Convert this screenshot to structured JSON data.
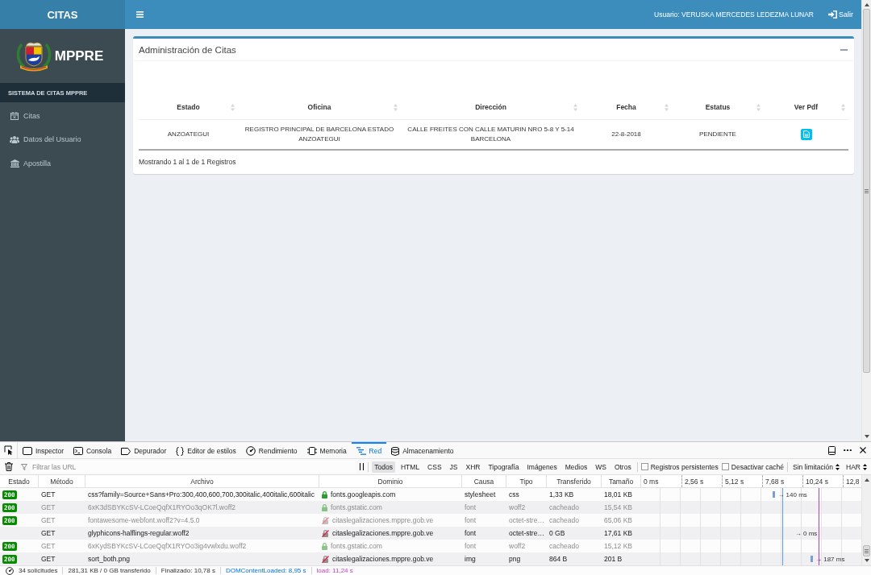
{
  "header": {
    "brand": "CITAS",
    "user": "Usuario: VERUSKA MERCEDES LEDEZMA LUNAR",
    "logout": "Salir"
  },
  "sidebar": {
    "logo_text": "MPPRE",
    "section": "SISTEMA DE CITAS MPPRE",
    "items": [
      {
        "label": "Citas",
        "selected": false
      },
      {
        "label": "Datos del Usuario",
        "selected": false
      },
      {
        "label": "Apostilla",
        "selected": false
      }
    ]
  },
  "panel": {
    "title": "Administración de Citas",
    "table": {
      "columns": [
        "Estado",
        "Oficina",
        "Dirección",
        "Fecha",
        "Estatus",
        "Ver Pdf"
      ],
      "rows": [
        {
          "cells": [
            "ANZOATEGUI",
            "REGISTRO PRINCIPAL DE BARCELONA ESTADO ANZOATEGUI",
            "CALLE FREITES CON CALLE MATURIN NRO 5-8 Y 5-14 BARCELONA",
            "22-8-2018",
            "PENDIENTE"
          ],
          "pdf": true
        }
      ]
    },
    "info": "Mostrando 1 al 1 de 1 Registros"
  },
  "devtools": {
    "tabs": [
      {
        "label": "Inspector",
        "selected": false
      },
      {
        "label": "Consola",
        "selected": false
      },
      {
        "label": "Depurador",
        "selected": false
      },
      {
        "label": "Editor de estilos",
        "selected": false
      },
      {
        "label": "Rendimiento",
        "selected": false
      },
      {
        "label": "Memoria",
        "selected": false
      },
      {
        "label": "Red",
        "selected": true
      },
      {
        "label": "Almacenamiento",
        "selected": false
      }
    ],
    "filter": {
      "placeholder": "Filtrar las URL"
    },
    "type_filters": [
      {
        "label": "Todos",
        "selected": true
      },
      {
        "label": "HTML",
        "selected": false
      },
      {
        "label": "CSS",
        "selected": false
      },
      {
        "label": "JS",
        "selected": false
      },
      {
        "label": "XHR",
        "selected": false
      },
      {
        "label": "Tipografía",
        "selected": false
      },
      {
        "label": "Imágenes",
        "selected": false
      },
      {
        "label": "Medios",
        "selected": false
      },
      {
        "label": "WS",
        "selected": false
      },
      {
        "label": "Otros",
        "selected": false
      }
    ],
    "options": [
      {
        "label": "Registros persistentes",
        "checked": false
      },
      {
        "label": "Desactivar caché",
        "checked": false
      }
    ],
    "throttling": "Sin limitación",
    "export": "HAR",
    "columns": [
      "Estado",
      "Método",
      "Archivo",
      "Dominio",
      "Causa",
      "Tipo",
      "Transferido",
      "Tamaño"
    ],
    "timeline": {
      "ticks": [
        "0 ms",
        "2,56 s",
        "5,12 s",
        "7,68 s",
        "10,24 s",
        "12,8"
      ],
      "markers": [
        {
          "kind": "domcontentloaded",
          "level": 0.642
        },
        {
          "kind": "load",
          "level": 0.806
        }
      ]
    },
    "requests": [
      {
        "status": "200",
        "method": "GET",
        "file": "css?family=Source+Sans+Pro:300,400,600,700,300italic,400italic,600italic",
        "secure": true,
        "domain": "fonts.googleapis.com",
        "cause": "stylesheet",
        "type": "css",
        "transferred": "1,33 KB",
        "size": "18,01 KB",
        "cached": false,
        "timing": {
          "level": 0.6,
          "bar": true,
          "label": "→ 140 ms"
        }
      },
      {
        "status": "200",
        "method": "GET",
        "file": "6xK3dSBYKcSV-LCoeQqfX1RYOo3qOK7l.woff2",
        "secure": true,
        "domain": "fonts.gstatic.com",
        "cause": "font",
        "type": "woff2",
        "transferred": "cacheado",
        "size": "15,54 KB",
        "cached": true
      },
      {
        "status": "200",
        "method": "GET",
        "file": "fontawesome-webfont.woff2?v=4.5.0",
        "secure": false,
        "domain": "citaslegalizaciones.mppre.gob.ve",
        "cause": "font",
        "type": "octet-stre…",
        "transferred": "cacheado",
        "size": "65,06 KB",
        "cached": true
      },
      {
        "method": "GET",
        "file": "glyphicons-halflings-regular.woff2",
        "secure": false,
        "domain": "citaslegalizaciones.mppre.gob.ve",
        "cause": "font",
        "type": "octet-stre…",
        "transferred": "0 GB",
        "size": "17,61 KB",
        "cached": false,
        "timing": {
          "level": 0.7,
          "bar": false,
          "label": "→ 0 ms"
        }
      },
      {
        "status": "200",
        "method": "GET",
        "file": "6xKydSBYKcSV-LCoeQqfX1RYOo3ig4vwlxdu.woff2",
        "secure": true,
        "domain": "fonts.gstatic.com",
        "cause": "font",
        "type": "woff2",
        "transferred": "cacheado",
        "size": "15,12 KB",
        "cached": true
      },
      {
        "status": "200",
        "method": "GET",
        "file": "sort_both.png",
        "secure": false,
        "domain": "citaslegalizaciones.mppre.gob.ve",
        "cause": "img",
        "type": "png",
        "transferred": "864 B",
        "size": "201 B",
        "cached": false,
        "timing": {
          "level": 0.77,
          "bar": true,
          "label": "→ 187 ms"
        }
      }
    ],
    "summary": [
      {
        "kind": "plain",
        "text": "34 solicitudes"
      },
      {
        "kind": "plain",
        "text": "281,31 KB / 0 GB transferido"
      },
      {
        "kind": "plain",
        "text": "Finalizado: 10,78 s"
      },
      {
        "kind": "domcontentloaded",
        "text": "DOMContentLoaded: 8,95 s"
      },
      {
        "kind": "load",
        "text": "load: 11,24 s"
      }
    ]
  }
}
